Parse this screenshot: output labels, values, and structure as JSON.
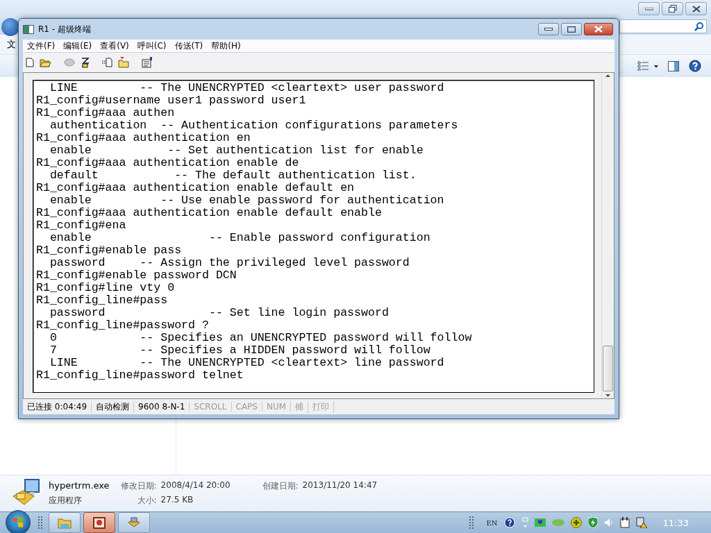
{
  "explorer": {
    "menu_fragment": "文",
    "details": {
      "file_name": "hypertrm.exe",
      "modified_label": "修改日期:",
      "modified": "2008/4/14 20:00",
      "created_label": "创建日期:",
      "created": "2013/11/20 14:47",
      "type": "应用程序",
      "size_label": "大小:",
      "size": "27.5 KB"
    }
  },
  "window": {
    "title": "R1 - 超级终端",
    "menu": [
      "文件(F)",
      "编辑(E)",
      "查看(V)",
      "呼叫(C)",
      "传送(T)",
      "帮助(H)"
    ],
    "toolbar": [
      {
        "kind": "new",
        "disabled": false
      },
      {
        "kind": "open",
        "disabled": false
      },
      {
        "kind": "disconnect",
        "disabled": true
      },
      {
        "kind": "dial",
        "disabled": false
      },
      {
        "kind": "send",
        "disabled": false
      },
      {
        "kind": "receive",
        "disabled": false
      },
      {
        "kind": "properties",
        "disabled": false
      }
    ],
    "terminal_lines": [
      "  LINE         -- The UNENCRYPTED <cleartext> user password",
      "R1_config#username user1 password user1",
      "R1_config#aaa authen",
      "  authentication  -- Authentication configurations parameters",
      "R1_config#aaa authentication en",
      "  enable           -- Set authentication list for enable",
      "R1_config#aaa authentication enable de",
      "  default           -- The default authentication list.",
      "R1_config#aaa authentication enable default en",
      "  enable          -- Use enable password for authentication",
      "R1_config#aaa authentication enable default enable",
      "R1_config#ena",
      "  enable                 -- Enable password configuration",
      "R1_config#enable pass",
      "  password     -- Assign the privileged level password",
      "R1_config#enable password DCN",
      "R1_config#line vty 0",
      "R1_config_line#pass",
      "  password               -- Set line login password",
      "R1_config_line#password ?",
      "  0            -- Specifies an UNENCRYPTED password will follow",
      "  7            -- Specifies a HIDDEN password will follow",
      "  LINE         -- The UNENCRYPTED <cleartext> line password",
      "R1_config_line#password telnet"
    ],
    "status": [
      {
        "text": "已连接 0:04:49",
        "disabled": false
      },
      {
        "text": "自动检测",
        "disabled": false
      },
      {
        "text": "9600 8-N-1",
        "disabled": false
      },
      {
        "text": "SCROLL",
        "disabled": true
      },
      {
        "text": "CAPS",
        "disabled": true
      },
      {
        "text": "NUM",
        "disabled": true
      },
      {
        "text": "捕",
        "disabled": true
      },
      {
        "text": "打印",
        "disabled": true
      }
    ]
  },
  "taskbar": {
    "buttons": [
      {
        "kind": "folder",
        "selected": false
      },
      {
        "kind": "presentation",
        "selected": true
      },
      {
        "kind": "terminal",
        "selected": false
      }
    ],
    "language": "EN",
    "clock": "11:33"
  }
}
